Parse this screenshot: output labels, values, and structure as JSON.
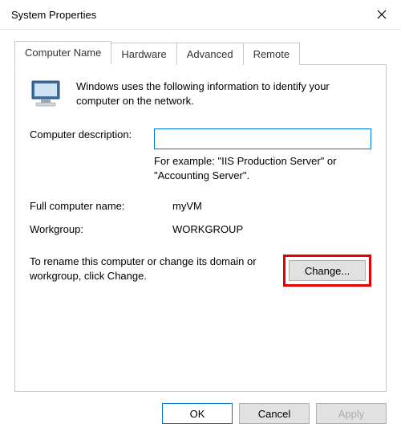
{
  "window": {
    "title": "System Properties"
  },
  "tabs": {
    "computer_name": "Computer Name",
    "hardware": "Hardware",
    "advanced": "Advanced",
    "remote": "Remote"
  },
  "panel": {
    "intro": "Windows uses the following information to identify your computer on the network.",
    "desc_label": "Computer description:",
    "desc_value": "",
    "desc_example": "For example: \"IIS Production Server\" or \"Accounting Server\".",
    "fullname_label": "Full computer name:",
    "fullname_value": "myVM",
    "workgroup_label": "Workgroup:",
    "workgroup_value": "WORKGROUP",
    "rename_text": "To rename this computer or change its domain or workgroup, click Change.",
    "change_label": "Change..."
  },
  "buttons": {
    "ok": "OK",
    "cancel": "Cancel",
    "apply": "Apply"
  }
}
